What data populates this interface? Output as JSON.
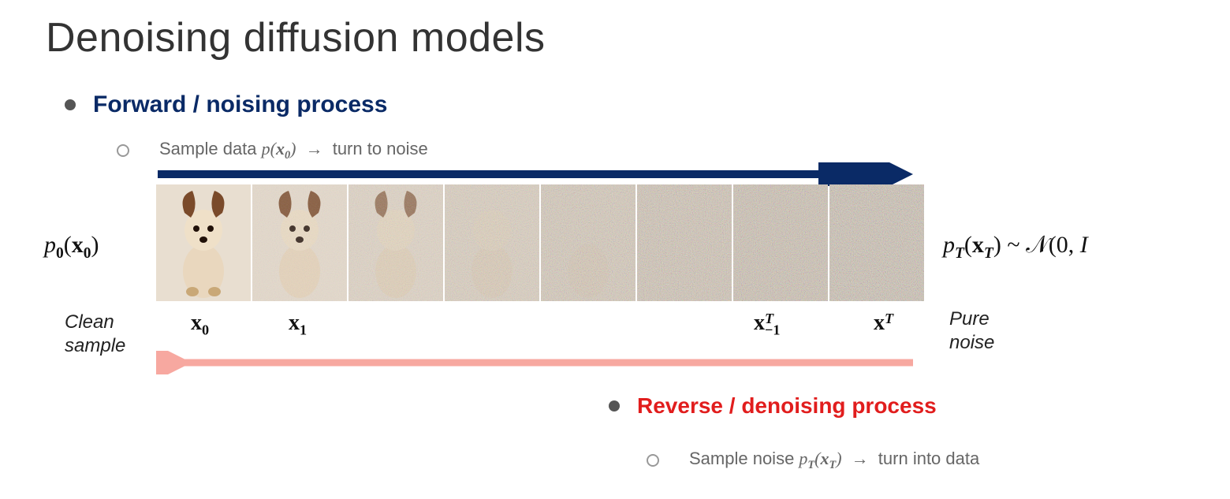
{
  "title": "Denoising diffusion models",
  "forward": {
    "heading": "Forward / noising process",
    "sub_prefix": "Sample data ",
    "sub_math": "p(𝐱₀)",
    "sub_suffix": "turn to noise"
  },
  "reverse": {
    "heading": "Reverse / denoising process",
    "sub_prefix": "Sample noise ",
    "sub_math": "p_T(𝐱_T)",
    "sub_suffix": "turn into data"
  },
  "left": {
    "dist": "p₀(𝐱₀)",
    "caption_l1": "Clean",
    "caption_l2": "sample"
  },
  "right": {
    "dist": "p_T(𝐱_T) ~ 𝒩(0, I",
    "caption_l1": "Pure",
    "caption_l2": "noise"
  },
  "xlabels": {
    "x0": "𝐱₀",
    "x1": "𝐱₁",
    "xTm1": "𝐱_{T−1}",
    "xT": "𝐱_T"
  },
  "colors": {
    "forward_arrow": "#0a2a66",
    "reverse_arrow": "#f7a8a0"
  },
  "tiles": {
    "count": 8,
    "noise_opacity": [
      0.0,
      0.22,
      0.42,
      0.58,
      0.72,
      0.85,
      0.94,
      1.0
    ]
  }
}
